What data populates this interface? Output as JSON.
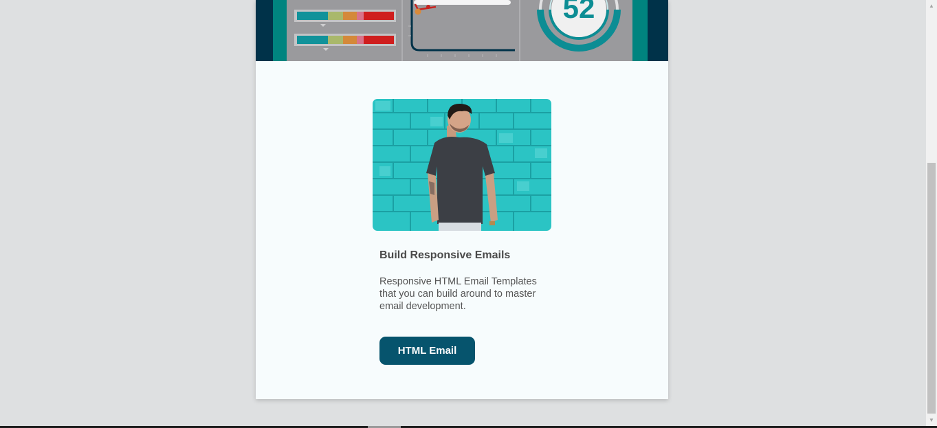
{
  "card": {
    "title": "Build Responsive Emails",
    "body": "Responsive HTML Email Templates that you can build around to master email development.",
    "button_label": "HTML Email"
  },
  "hero": {
    "gauge_number": "52",
    "icon": "dashboard-illustration"
  },
  "photo": {
    "icon": "man-against-turquoise-brick-wall-photo"
  },
  "colors": {
    "page_background": "#dee0e1",
    "card_background": "#f7fcfd",
    "button_background": "#06546d",
    "hero_dark": "#003249",
    "hero_teal": "#00847f",
    "wall_turquoise": "#2bc4c4"
  },
  "scrollbar": {
    "up_icon": "scroll-up-arrow-icon",
    "down_icon": "scroll-down-arrow-icon"
  }
}
